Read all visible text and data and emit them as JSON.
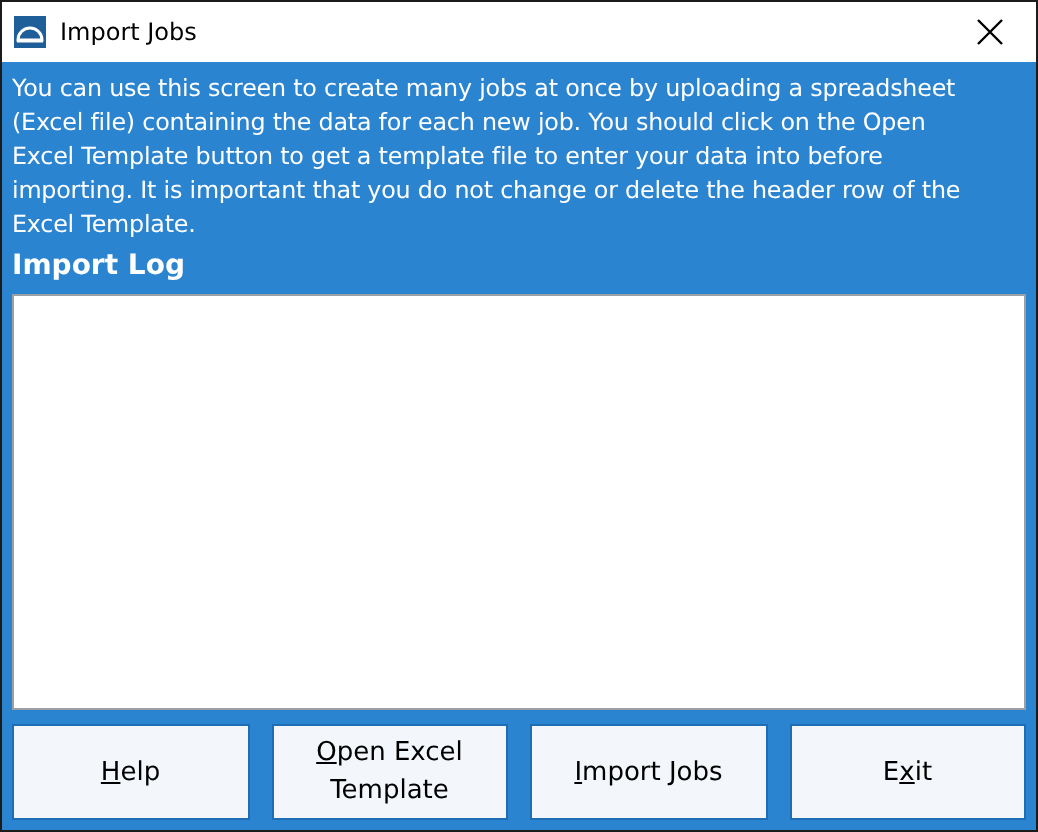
{
  "window": {
    "title": "Import Jobs"
  },
  "description": "You can use this screen to create many jobs at once by uploading a spreadsheet (Excel file) containing the data for each new job. You should click on the Open Excel Template button to get a template file to enter your data into before importing. It is important that you do not change or delete the header row of the Excel Template.",
  "import_log": {
    "label": "Import Log"
  },
  "buttons": [
    {
      "key": "H",
      "post": "elp"
    },
    {
      "key": "O",
      "post": "pen Excel Template"
    },
    {
      "key": "I",
      "post": "mport Jobs"
    },
    {
      "pre": "E",
      "key": "x",
      "post": "it"
    }
  ]
}
